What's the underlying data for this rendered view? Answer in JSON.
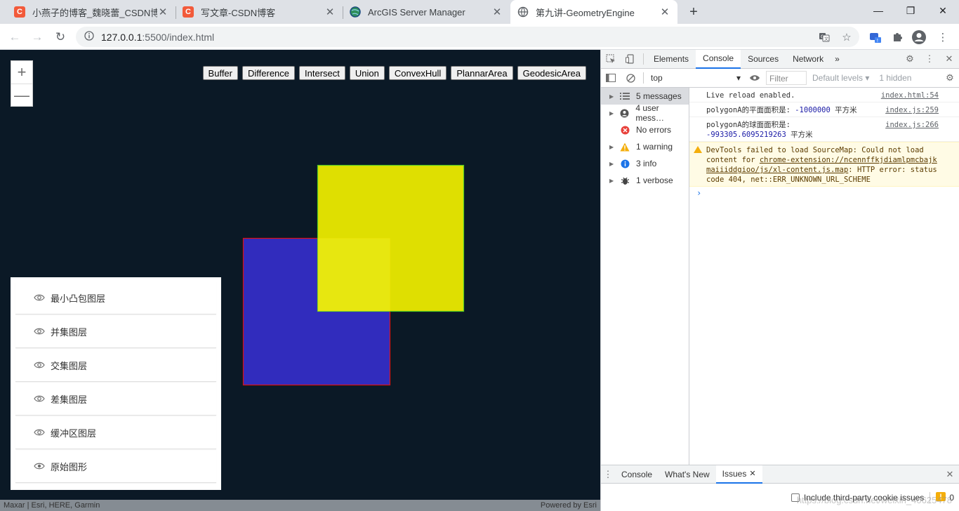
{
  "browser": {
    "tabs": [
      {
        "title": "小燕子的博客_魏晓蕾_CSDN博客",
        "favicon": "C"
      },
      {
        "title": "写文章-CSDN博客",
        "favicon": "C"
      },
      {
        "title": "ArcGIS Server Manager",
        "favicon": ""
      },
      {
        "title": "第九讲-GeometryEngine",
        "favicon": ""
      }
    ],
    "new_tab": "+",
    "address": {
      "host": "127.0.0.1",
      "path": ":5500/index.html"
    }
  },
  "map": {
    "zoom_in": "+",
    "zoom_out": "—",
    "buttons": [
      "Buffer",
      "Difference",
      "Intersect",
      "Union",
      "ConvexHull",
      "PlannarArea",
      "GeodesicArea"
    ],
    "layers": [
      "最小凸包图层",
      "并集图层",
      "交集图层",
      "差集图层",
      "缓冲区图层",
      "原始图形"
    ],
    "attribution_left": "Maxar | Esri, HERE, Garmin",
    "attribution_right": "Powered by Esri",
    "colors": {
      "polygon_a_fill": "#312cbd",
      "polygon_a_stroke": "#e01010",
      "polygon_b_fill": "#e6e600",
      "polygon_b_stroke": "#55cc22",
      "background": "#0b1926"
    }
  },
  "devtools": {
    "tabs": [
      "Elements",
      "Console",
      "Sources",
      "Network"
    ],
    "more": "»",
    "context": "top",
    "filter_placeholder": "Filter",
    "levels": "Default levels",
    "hidden": "1 hidden",
    "sidebar": [
      {
        "label": "5 messages",
        "icon": "list-icon"
      },
      {
        "label": "4 user mess…",
        "icon": "user-icon"
      },
      {
        "label": "No errors",
        "icon": "error-icon"
      },
      {
        "label": "1 warning",
        "icon": "warning-icon"
      },
      {
        "label": "3 info",
        "icon": "info-icon"
      },
      {
        "label": "1 verbose",
        "icon": "bug-icon"
      }
    ],
    "messages": {
      "m1": {
        "text": "Live reload enabled.",
        "src": "index.html:54"
      },
      "m2": {
        "prefix": "polygonA的平面面积是:",
        "value": "-1000000",
        "unit": "平方米",
        "src": "index.js:259"
      },
      "m3": {
        "prefix": "polygonA的球面面积是:",
        "value": "-993305.6095219263",
        "unit": "平方米",
        "src": "index.js:266"
      },
      "warn": {
        "pre": "DevTools failed to load SourceMap: Could not load content for ",
        "link": "chrome-extension://ncennffkjdiamlpmcbajkmaiiiddgioo/js/xl-content.js.map",
        "post": ": HTTP error: status code 404, net::ERR_UNKNOWN_URL_SCHEME"
      }
    },
    "prompt": "›",
    "drawer_tabs": [
      "Console",
      "What's New",
      "Issues"
    ],
    "issues_checkbox": "Include third-party cookie issues",
    "issues_count": "0"
  },
  "watermark": "https://blog.csdn.net/weixin_40625478"
}
